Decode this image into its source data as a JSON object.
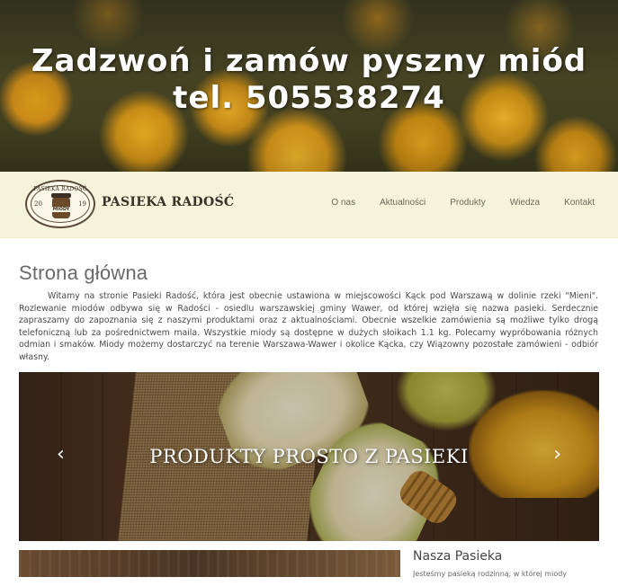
{
  "hero": {
    "line1": "Zadzwoń i zamów pyszny miód",
    "line2": "tel. 505538274"
  },
  "logo": {
    "arc_text": "PASIEKA RADOŚĆ",
    "year_left": "20",
    "year_right": "19",
    "jar_label": "MIODY"
  },
  "brand_name": "PASIEKA RADOŚĆ",
  "nav": [
    {
      "label": "O nas"
    },
    {
      "label": "Aktualności"
    },
    {
      "label": "Produkty"
    },
    {
      "label": "Wiedza"
    },
    {
      "label": "Kontakt"
    }
  ],
  "main": {
    "title": "Strona główna",
    "intro": "Witamy na stronie Pasieki Radość, która jest obecnie ustawiona w miejscowości Kąck pod Warszawą w dolinie rzeki \"Mieni\". Rozlewanie miodów odbywa się w Radości - osiedlu warszawskiej gminy Wawer, od której wzięła się nazwa pasieki. Serdecznie zapraszamy do zapoznania się z naszymi produktami oraz z aktualnościami. Obecnie wszelkie zamówienia są możliwe tylko drogą telefoniczną lub za pośrednictwem maila. Wszystkie miody są dostępne w dużych słoikach 1.1 kg. Polecamy wypróbowania różnych odmian i smaków. Miody możemy dostarczyć na terenie Warszawa-Wawer i okolice Kącka, czy Wiązowny pozostałe zamówieni - odbiór własny."
  },
  "slider": {
    "caption": "PRODUKTY PROSTO Z PASIEKI",
    "prev": "‹",
    "next": "›"
  },
  "section": {
    "title": "Nasza Pasieka",
    "text": "Jesteśmy pasieką rodzinną, w której miody"
  }
}
